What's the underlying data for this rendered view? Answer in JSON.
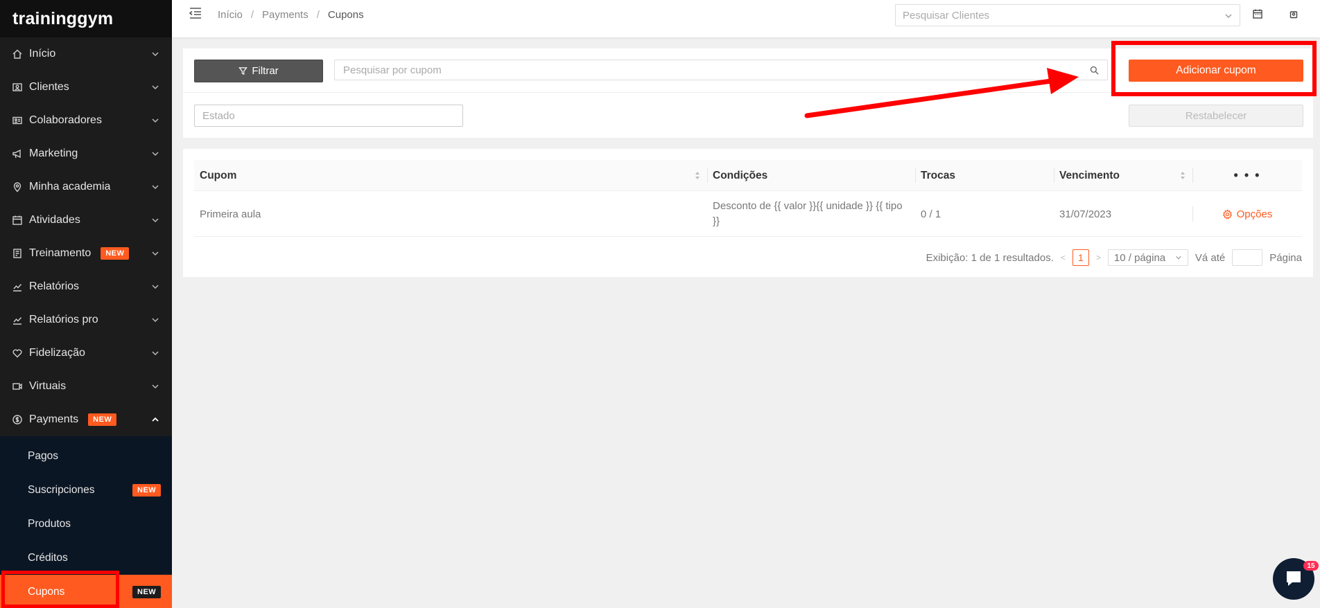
{
  "app": {
    "logo": "traininggym"
  },
  "sidebar": {
    "items": [
      {
        "label": "Início",
        "icon": "home-icon"
      },
      {
        "label": "Clientes",
        "icon": "id-card-icon"
      },
      {
        "label": "Colaboradores",
        "icon": "badge-icon"
      },
      {
        "label": "Marketing",
        "icon": "megaphone-icon"
      },
      {
        "label": "Minha academia",
        "icon": "location-pin-icon"
      },
      {
        "label": "Atividades",
        "icon": "calendar-icon"
      },
      {
        "label": "Treinamento",
        "icon": "clipboard-icon",
        "badge": "NEW"
      },
      {
        "label": "Relatórios",
        "icon": "line-chart-icon"
      },
      {
        "label": "Relatórios pro",
        "icon": "line-chart-icon"
      },
      {
        "label": "Fidelização",
        "icon": "heart-icon"
      },
      {
        "label": "Virtuais",
        "icon": "video-icon"
      },
      {
        "label": "Payments",
        "icon": "dollar-circle-icon",
        "badge": "NEW"
      }
    ],
    "payments_sub": [
      {
        "label": "Pagos"
      },
      {
        "label": "Suscripciones",
        "badge": "NEW"
      },
      {
        "label": "Produtos"
      },
      {
        "label": "Créditos"
      },
      {
        "label": "Cupons",
        "badge": "NEW"
      }
    ]
  },
  "topbar": {
    "breadcrumb": [
      "Início",
      "Payments",
      "Cupons"
    ],
    "breadcrumb_sep": "/",
    "client_search_placeholder": "Pesquisar Clientes"
  },
  "filters": {
    "filter_button": "Filtrar",
    "search_placeholder": "Pesquisar por cupom",
    "add_button": "Adicionar cupom",
    "estado_placeholder": "Estado",
    "reset_button": "Restabelecer"
  },
  "table": {
    "columns": [
      "Cupom",
      "Condições",
      "Trocas",
      "Vencimento",
      "• • •"
    ],
    "rows": [
      {
        "cupom": "Primeira aula",
        "condicoes": "Desconto de {{ valor }}{{ unidade }} {{ tipo }}",
        "trocas": "0 / 1",
        "vencimento": "31/07/2023",
        "opcoes": "Opções"
      }
    ]
  },
  "pagination": {
    "summary": "Exibição: 1 de 1 resultados.",
    "current_page": "1",
    "page_size": "10 / página",
    "goto_label": "Vá até",
    "page_label": "Página"
  },
  "chat": {
    "unread": "15"
  },
  "colors": {
    "accent": "#ff5a1f",
    "sidebar_bg": "#1c1c1c",
    "submenu_bg": "#0b1624",
    "annotation": "#ff0000"
  }
}
